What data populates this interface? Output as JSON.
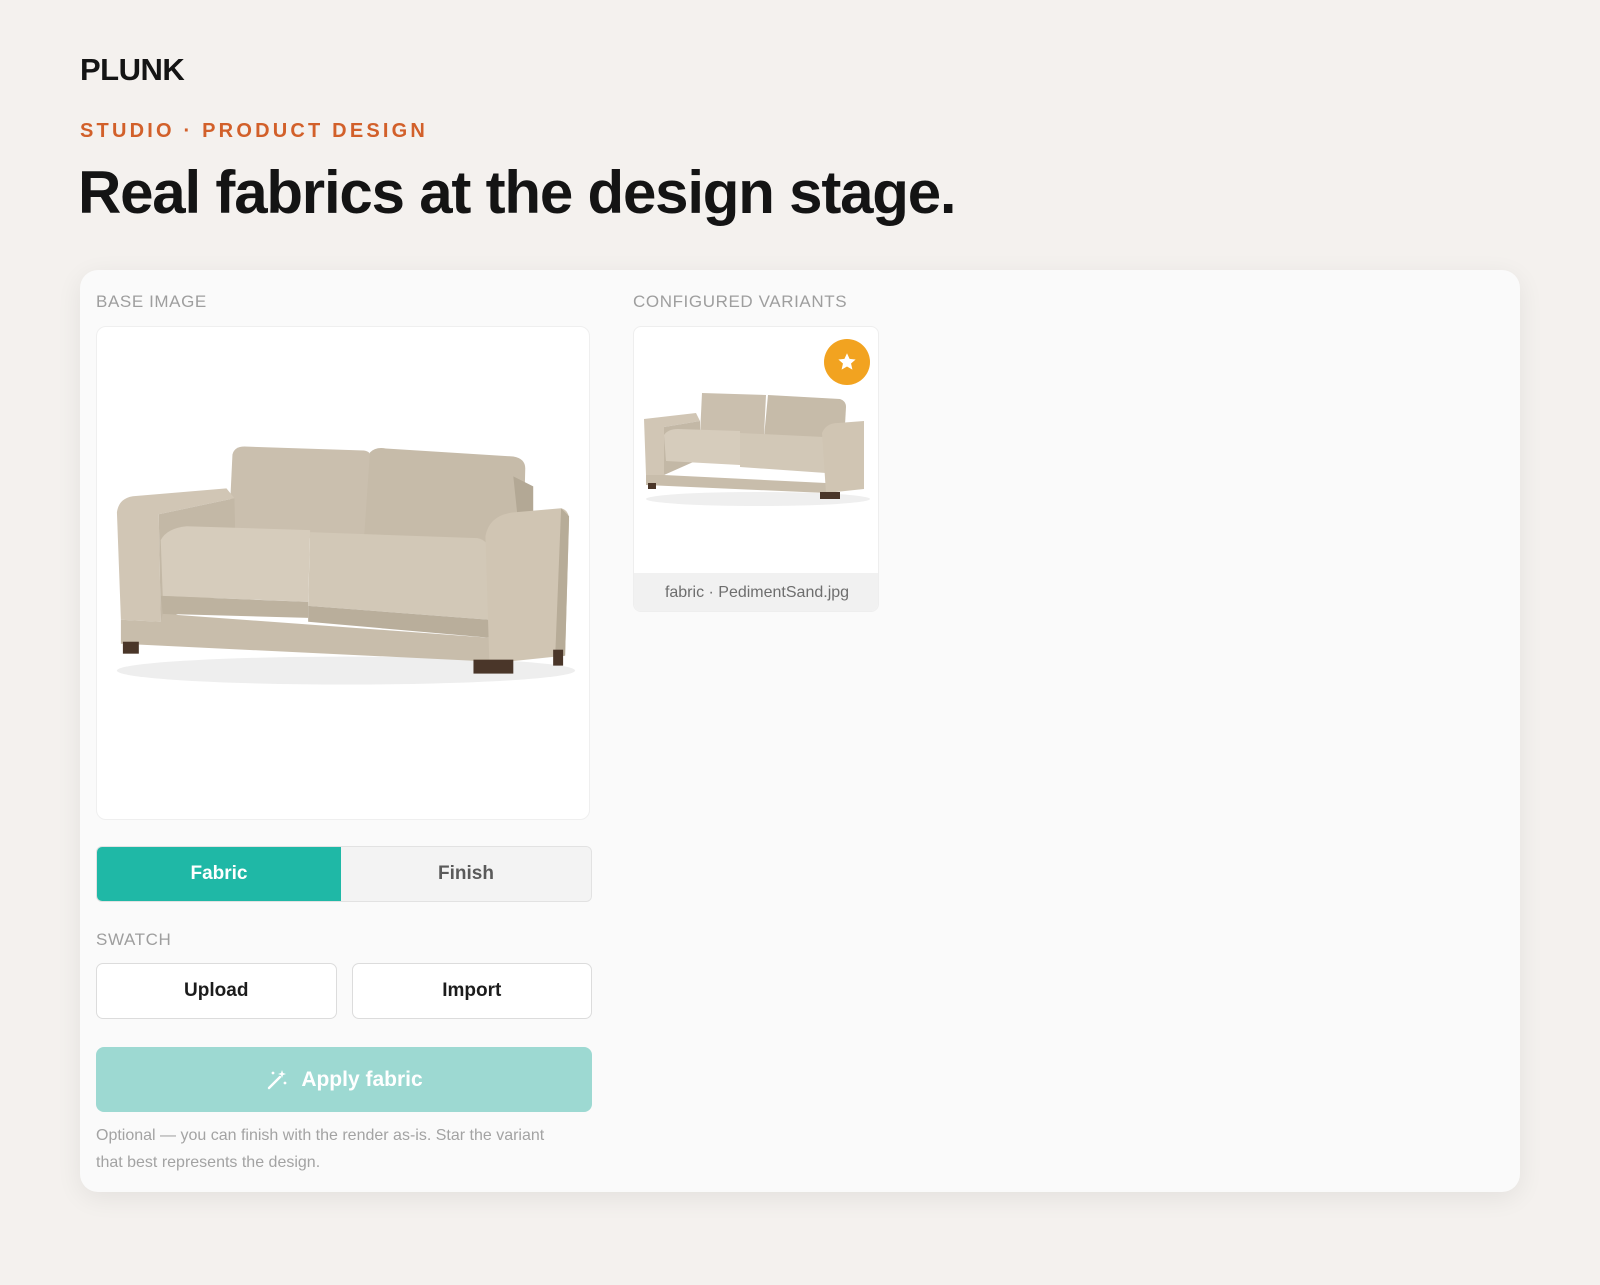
{
  "brand": "PLUNK",
  "eyebrow": "STUDIO · PRODUCT DESIGN",
  "headline": "Real fabrics at the design stage.",
  "panel": {
    "base_label": "BASE IMAGE",
    "variants_label": "CONFIGURED VARIANTS",
    "mode_tabs": {
      "fabric": "Fabric",
      "finish": "Finish",
      "selected": "Fabric"
    },
    "swatch_label": "SWATCH",
    "upload_label": "Upload",
    "import_label": "Import",
    "apply_label": "Apply fabric",
    "apply_icon": "magic-wand-icon",
    "helper_text": "Optional — you can finish with the render as-is. Star the variant that best represents the design.",
    "variants": [
      {
        "caption": "fabric · PedimentSand.jpg",
        "starred": true,
        "star_icon": "star-icon"
      }
    ]
  },
  "colors": {
    "accent_teal": "#1fb8a6",
    "apply_disabled": "#9dd9d2",
    "eyebrow_orange": "#d2602a",
    "star_orange": "#f2a320",
    "sofa_fabric": "#cfc4b4"
  }
}
